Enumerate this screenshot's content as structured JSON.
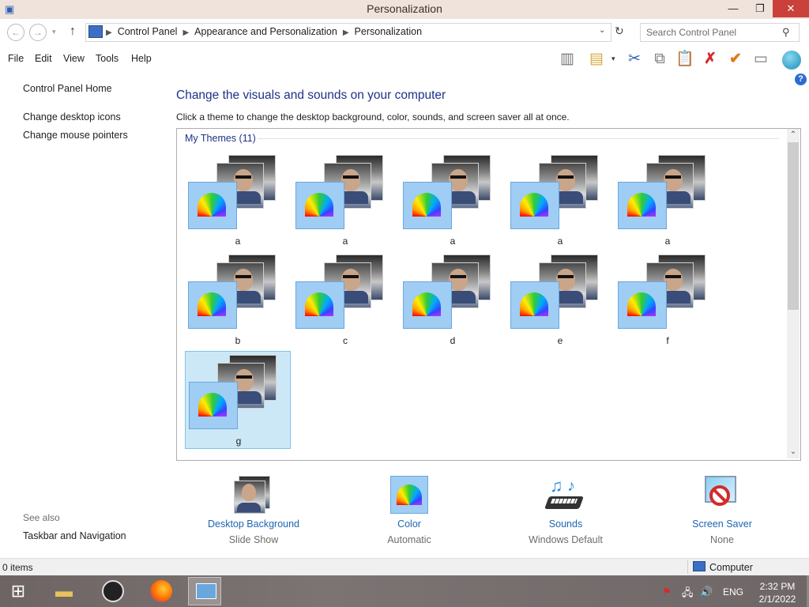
{
  "window": {
    "title": "Personalization"
  },
  "address": {
    "crumbs": [
      "Control Panel",
      "Appearance and Personalization",
      "Personalization"
    ],
    "search_placeholder": "Search Control Panel"
  },
  "menu": [
    "File",
    "Edit",
    "View",
    "Tools",
    "Help"
  ],
  "left_pane": {
    "links": [
      "Control Panel Home",
      "Change desktop icons",
      "Change mouse pointers"
    ],
    "see_also": "See also",
    "see_also_links": [
      "Taskbar and Navigation"
    ]
  },
  "main": {
    "heading": "Change the visuals and sounds on your computer",
    "subtext": "Click a theme to change the desktop background, color, sounds, and screen saver all at once.",
    "group_name": "My Themes (11)",
    "themes": [
      "a",
      "a",
      "a",
      "a",
      "a",
      "b",
      "c",
      "d",
      "e",
      "f",
      "g"
    ],
    "selected_theme_index": 10
  },
  "options": [
    {
      "name": "Desktop Background",
      "value": "Slide Show",
      "icon": "desktop-background-icon"
    },
    {
      "name": "Color",
      "value": "Automatic",
      "icon": "color-icon"
    },
    {
      "name": "Sounds",
      "value": "Windows Default",
      "icon": "sounds-icon"
    },
    {
      "name": "Screen Saver",
      "value": "None",
      "icon": "screen-saver-icon"
    }
  ],
  "status": {
    "items": "0 items",
    "location": "Computer"
  },
  "taskbar": {
    "language": "ENG",
    "time": "2:32 PM",
    "date": "2/1/2022"
  },
  "colors": {
    "heading": "#1e3287",
    "link": "#1e66b4",
    "selection": "#cce8f6",
    "close": "#c9413a"
  }
}
